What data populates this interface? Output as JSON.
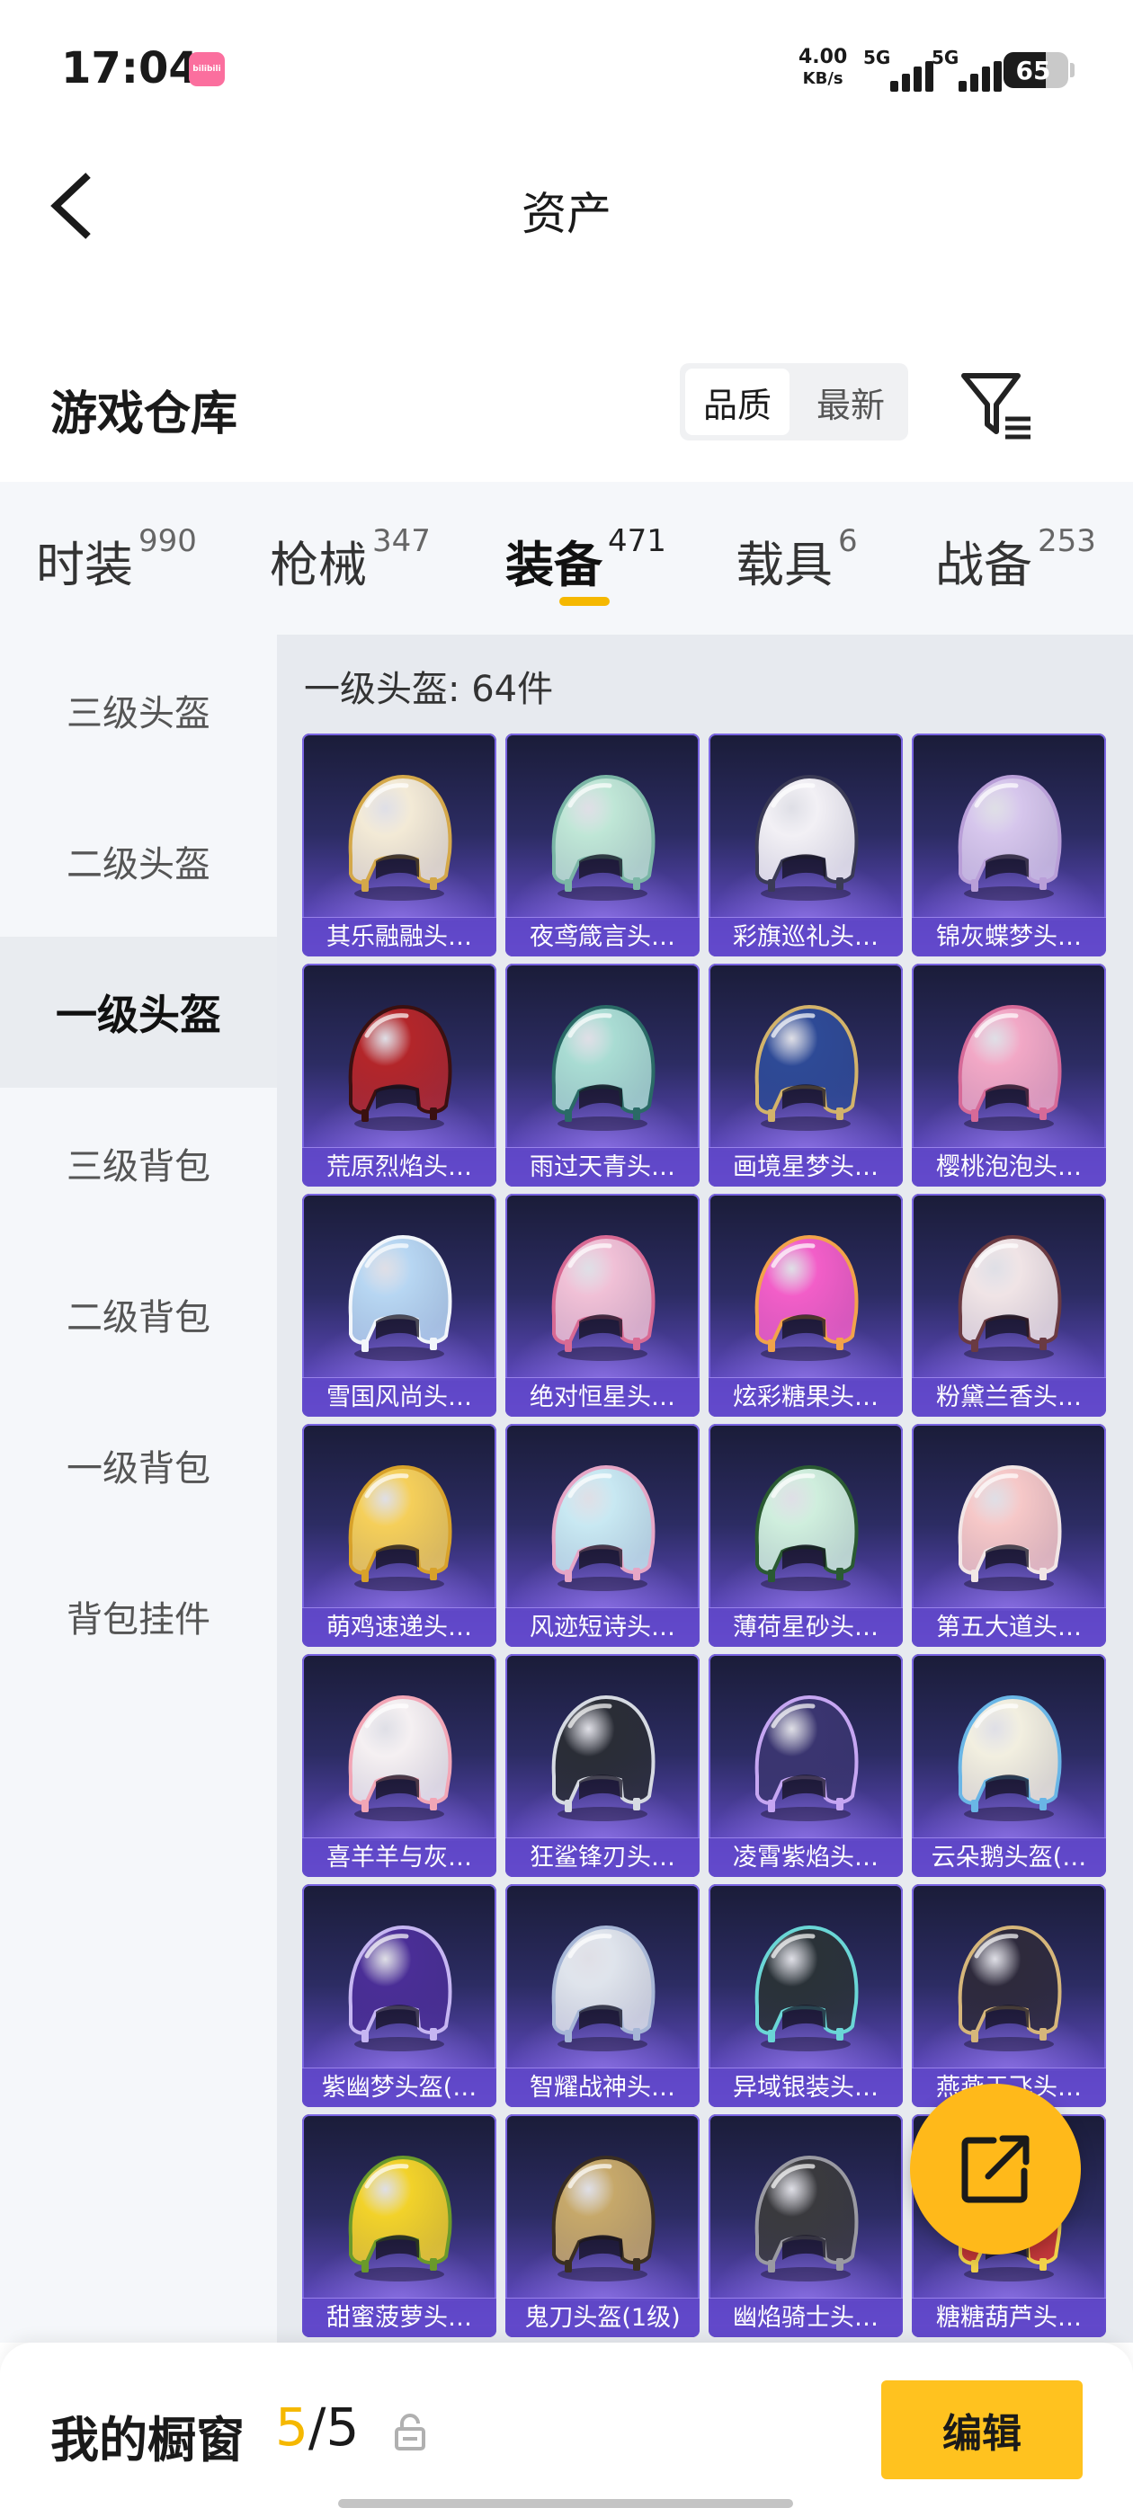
{
  "status_bar": {
    "time": "17:04",
    "app_badge": "bilibili",
    "net_speed": "4.00",
    "net_speed_unit": "KB/s",
    "sim1": "5G",
    "sim2": "5G",
    "battery": "65",
    "battery_level": 0.65
  },
  "header": {
    "title": "资产",
    "back_icon": "chevron-left-icon"
  },
  "section": {
    "title": "游戏仓库",
    "sort_options": [
      "品质",
      "最新"
    ],
    "sort_selected": "品质",
    "filter_icon": "filter-icon"
  },
  "tabs": [
    {
      "label": "时装",
      "count": "990"
    },
    {
      "label": "枪械",
      "count": "347"
    },
    {
      "label": "装备",
      "count": "471"
    },
    {
      "label": "载具",
      "count": "6"
    },
    {
      "label": "战备",
      "count": "253"
    }
  ],
  "active_tab": "装备",
  "sidebar": {
    "items": [
      "三级头盔",
      "二级头盔",
      "一级头盔",
      "三级背包",
      "二级背包",
      "一级背包",
      "背包挂件"
    ],
    "selected": "一级头盔"
  },
  "grid": {
    "header": "一级头盔: 64件",
    "items": [
      {
        "name": "其乐融融头…",
        "color": "#f3ead6",
        "trim": "#d4a84a"
      },
      {
        "name": "夜鸢箴言头…",
        "color": "#bfe6d6",
        "trim": "#7bb6a6"
      },
      {
        "name": "彩旗巡礼头…",
        "color": "#f2f0f5",
        "trim": "#3a3a55"
      },
      {
        "name": "锦灰蝶梦头…",
        "color": "#d6c6ec",
        "trim": "#b99fd8"
      },
      {
        "name": "荒原烈焰头…",
        "color": "#b3262a",
        "trim": "#3a1010"
      },
      {
        "name": "雨过天青头…",
        "color": "#a9dcd3",
        "trim": "#2a6a66"
      },
      {
        "name": "画境星梦头…",
        "color": "#2e4a96",
        "trim": "#d3b36a"
      },
      {
        "name": "樱桃泡泡头…",
        "color": "#f2a8c6",
        "trim": "#d66a98"
      },
      {
        "name": "雪国风尚头…",
        "color": "#b7d6f2",
        "trim": "#f2f6fb"
      },
      {
        "name": "绝对恒星头…",
        "color": "#f0c0d6",
        "trim": "#d86a94"
      },
      {
        "name": "炫彩糖果头…",
        "color": "#f25ec8",
        "trim": "#f2a34a"
      },
      {
        "name": "粉黛兰香头…",
        "color": "#f0e4e6",
        "trim": "#6a3a42"
      },
      {
        "name": "萌鸡速递头…",
        "color": "#f5cf5a",
        "trim": "#d8a22a"
      },
      {
        "name": "风迹短诗头…",
        "color": "#c8e8f2",
        "trim": "#e6a6c6"
      },
      {
        "name": "薄荷星砂头…",
        "color": "#cfeedd",
        "trim": "#2a5a32"
      },
      {
        "name": "第五大道头…",
        "color": "#f6c8c8",
        "trim": "#f2e6e6"
      },
      {
        "name": "喜羊羊与灰…",
        "color": "#f5f0f2",
        "trim": "#f2a6b6"
      },
      {
        "name": "狂鲨锋刃头…",
        "color": "#2a2d36",
        "trim": "#d6dae2"
      },
      {
        "name": "凌霄紫焰头…",
        "color": "#3a3570",
        "trim": "#c6a6f2"
      },
      {
        "name": "云朵鹅头盔(…",
        "color": "#f2efe0",
        "trim": "#6ab6e6"
      },
      {
        "name": "紫幽梦头盔(…",
        "color": "#4a2e96",
        "trim": "#c6b6f2"
      },
      {
        "name": "智耀战神头…",
        "color": "#dfe4ec",
        "trim": "#a6b6d6"
      },
      {
        "name": "异域银装头…",
        "color": "#2a3238",
        "trim": "#6ad6d6"
      },
      {
        "name": "燕燕于飞头…",
        "color": "#2e2a3c",
        "trim": "#d6b67a"
      },
      {
        "name": "甜蜜菠萝头…",
        "color": "#f2d22a",
        "trim": "#6a9a2a"
      },
      {
        "name": "鬼刀头盔(1级)",
        "color": "#c6a86a",
        "trim": "#3a2e22"
      },
      {
        "name": "幽焰骑士头…",
        "color": "#3a3a3e",
        "trim": "#9a9aa2"
      },
      {
        "name": "糖糖葫芦头…",
        "color": "#d6362a",
        "trim": "#f2d24a"
      }
    ]
  },
  "share_icon": "share-icon",
  "bottom_bar": {
    "label": "我的橱窗",
    "current": "5",
    "separator": "/",
    "total": "5",
    "lock_icon": "lock-icon",
    "edit_label": "编辑"
  }
}
